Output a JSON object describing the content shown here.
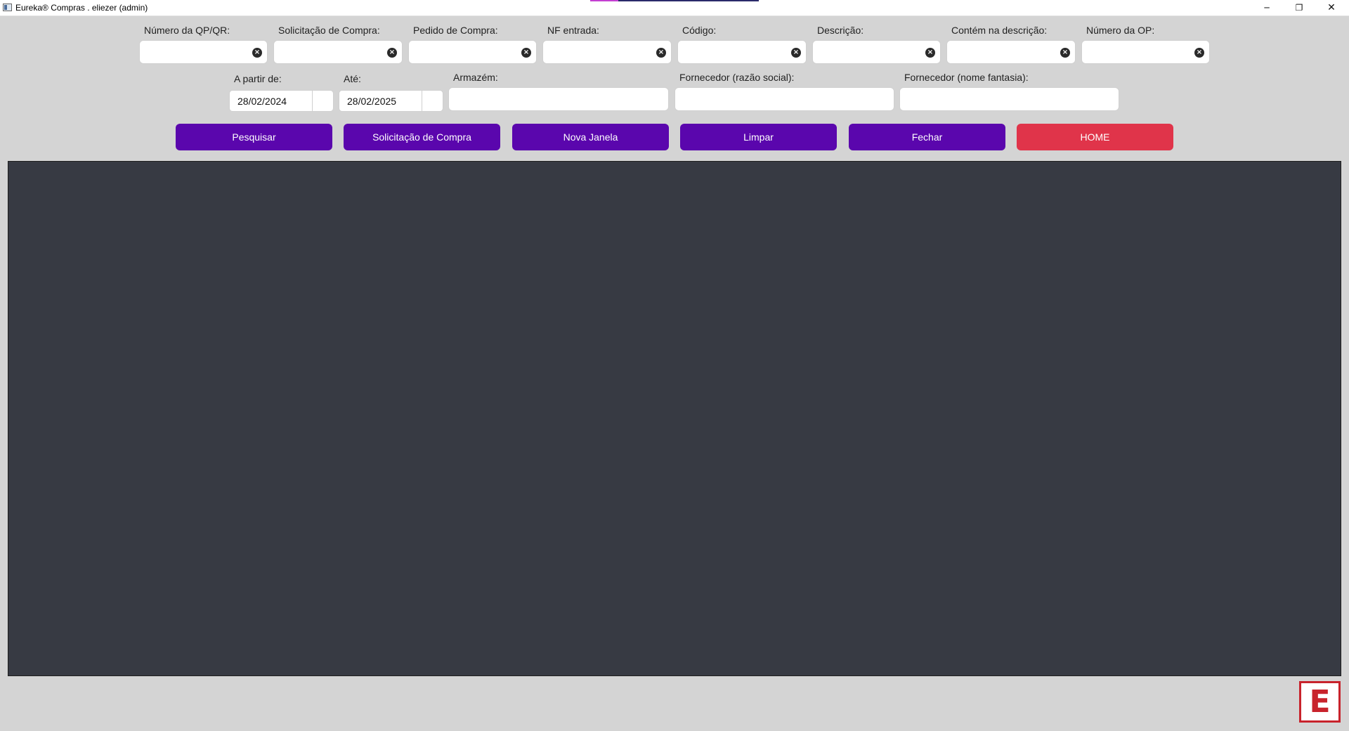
{
  "window": {
    "title": "Eureka® Compras . eliezer (admin)",
    "minimize_glyph": "─",
    "maximize_glyph": "❐",
    "close_glyph": "✕"
  },
  "filters_row1": [
    {
      "label": "Número da QP/QR:",
      "value": ""
    },
    {
      "label": "Solicitação de Compra:",
      "value": ""
    },
    {
      "label": "Pedido de Compra:",
      "value": ""
    },
    {
      "label": "NF entrada:",
      "value": ""
    },
    {
      "label": "Código:",
      "value": ""
    },
    {
      "label": "Descrição:",
      "value": ""
    },
    {
      "label": "Contém na descrição:",
      "value": ""
    },
    {
      "label": "Número da OP:",
      "value": ""
    }
  ],
  "clear_glyph": "×",
  "filters_row2": {
    "date_from": {
      "label": "A partir de:",
      "value": "28/02/2024"
    },
    "date_to": {
      "label": "Até:",
      "value": "28/02/2025"
    },
    "armazem": {
      "label": "Armazém:",
      "value": ""
    },
    "fornecedor_razao": {
      "label": "Fornecedor (razão social):",
      "value": ""
    },
    "fornecedor_fantasia": {
      "label": "Fornecedor (nome fantasia):",
      "value": ""
    }
  },
  "buttons": {
    "pesquisar": "Pesquisar",
    "solicitacao": "Solicitação de Compra",
    "nova_janela": "Nova Janela",
    "limpar": "Limpar",
    "fechar": "Fechar",
    "home": "HOME"
  },
  "colors": {
    "primary_button": "#5a06ad",
    "home_button": "#e0344a",
    "results_panel": "#373a43",
    "background": "#d4d4d4",
    "logo_red": "#c8232c"
  },
  "logo": {
    "letter": "E"
  }
}
